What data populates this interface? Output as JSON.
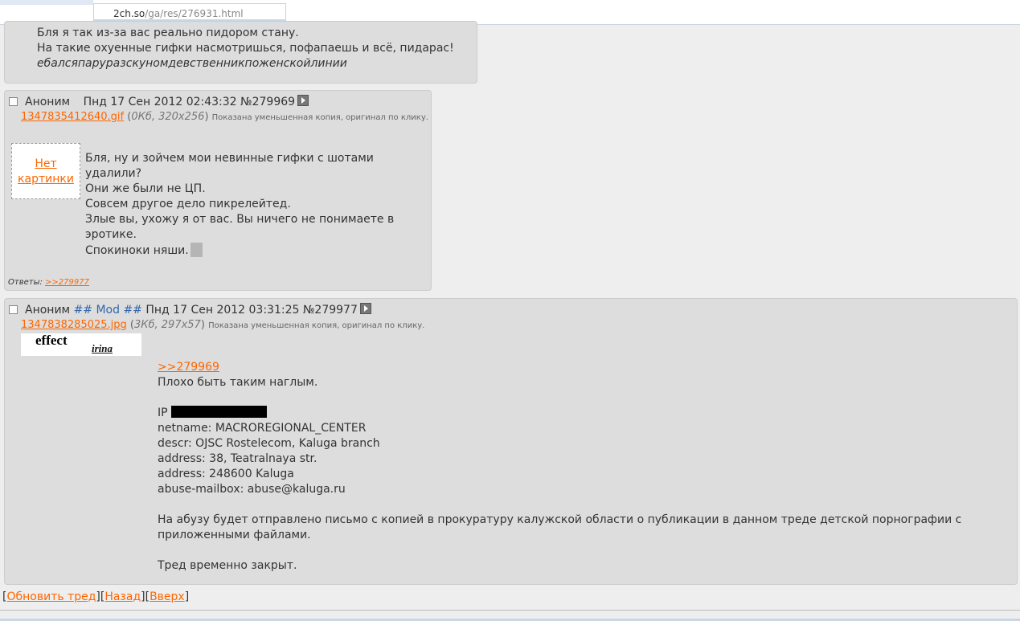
{
  "browser": {
    "url_host": "2ch.so",
    "url_path": "/ga/res/276931.html"
  },
  "post_top": {
    "lines": [
      "Бля я так из-за вас реально пидором стану.",
      "На такие охуенные гифки насмотришься, пофапаешь и всё, пидарас!"
    ],
    "signature": "ебалсяпаруразскуномдевственникпоженскойлинии"
  },
  "post_1": {
    "name": "Аноним",
    "date": "Пнд 17 Сен 2012 02:43:32",
    "num": "№279969",
    "file_name": "1347835412640.gif",
    "file_meta": "0Кб, 320x256",
    "file_note": "Показана уменьшенная копия, оригинал по клику.",
    "no_image": [
      "Нет",
      "картинки"
    ],
    "lines": [
      "Бля, ну и зойчем мои невинные гифки с шотами",
      "удалили?",
      "Они же были не ЦП.",
      "Совсем другое дело пикрелейтед.",
      "Злые вы, ухожу я от вас. Вы ничего не понимаете в",
      "эротике.",
      "Спокиноки няши."
    ],
    "answers_label": "Ответы:",
    "answers_link": ">>279977"
  },
  "post_2": {
    "name": "Аноним",
    "mod_tag": "## Mod ##",
    "date": "Пнд 17 Сен 2012 03:31:25",
    "num": "№279977",
    "file_name": "1347838285025.jpg",
    "file_meta": "3Кб, 297x57",
    "file_note": "Показана уменьшенная копия, оригинал по клику.",
    "thumb_word": "effect",
    "thumb_script": "irina",
    "reply_link": ">>279969",
    "line_1": "Плохо быть таким наглым.",
    "ip_label": "IP",
    "whois": [
      "netname: MACROREGIONAL_CENTER",
      "descr: OJSC Rostelecom, Kaluga branch",
      "address: 38, Teatralnaya str.",
      "address: 248600 Kaluga",
      "abuse-mailbox: abuse@kaluga.ru"
    ],
    "warning": [
      "На абузу будет отправлено письмо с копией в прокуратуру калужской области о публикации в данном треде детской порнографии с",
      "приложенными файлами."
    ],
    "closed": "Тред временно закрыт."
  },
  "nav": {
    "refresh": "Обновить тред",
    "back": "Назад",
    "top": "Вверх"
  }
}
